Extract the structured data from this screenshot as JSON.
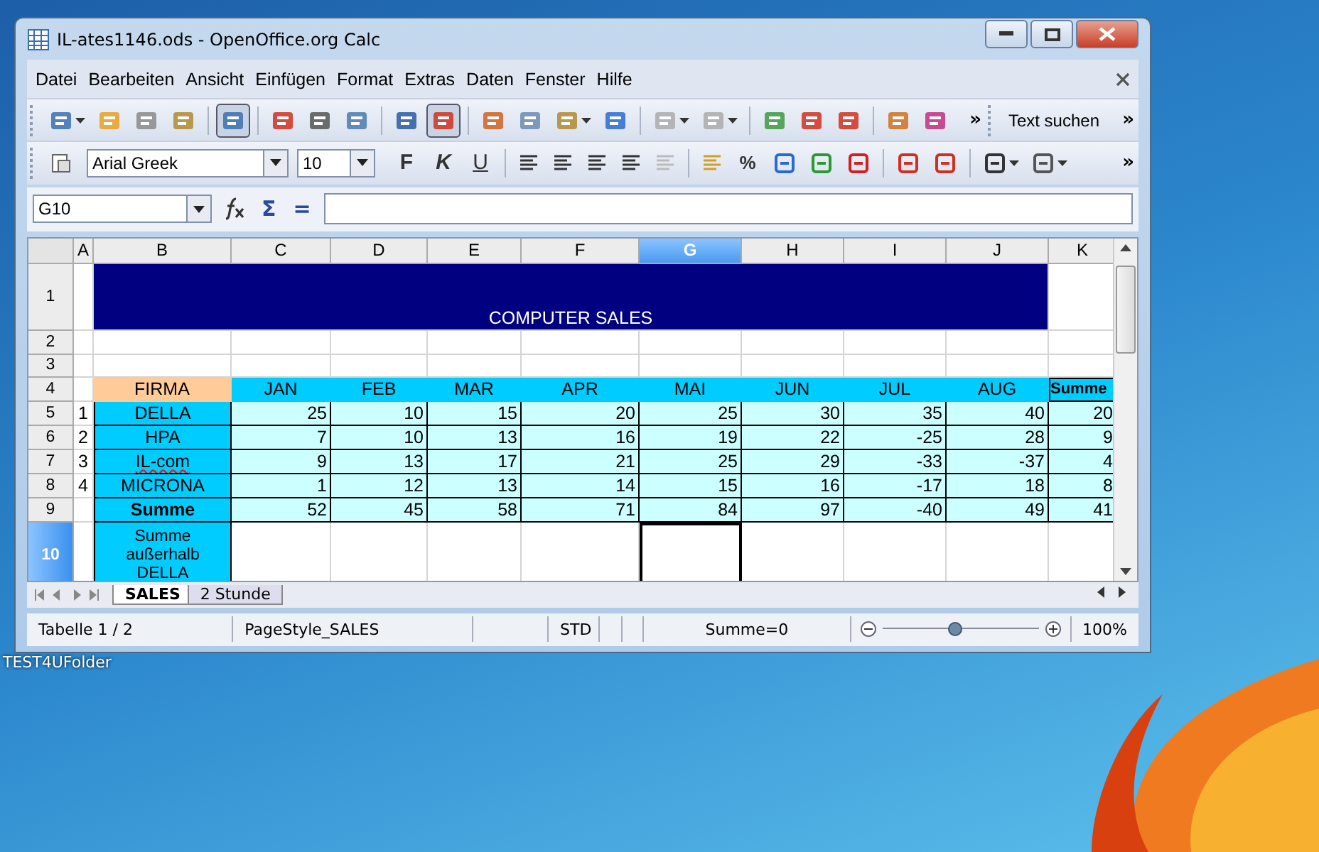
{
  "window": {
    "title": "IL-ates1146.ods - OpenOffice.org Calc"
  },
  "menu": [
    "Datei",
    "Bearbeiten",
    "Ansicht",
    "Einfügen",
    "Format",
    "Extras",
    "Daten",
    "Fenster",
    "Hilfe"
  ],
  "toolbar": {
    "overflow": "»",
    "find_label": "Text suchen"
  },
  "format_bar": {
    "font": "Arial Greek",
    "size": "10",
    "text_buttons": [
      "F",
      "K",
      "U"
    ],
    "percent": "%",
    "overflow": "»"
  },
  "formula_bar": {
    "name_box": "G10",
    "buttons": [
      "Σ",
      "="
    ]
  },
  "sheet": {
    "columns": [
      {
        "label": "A",
        "selected": false
      },
      {
        "label": "B",
        "selected": false
      },
      {
        "label": "C",
        "selected": false
      },
      {
        "label": "D",
        "selected": false
      },
      {
        "label": "E",
        "selected": false
      },
      {
        "label": "F",
        "selected": false
      },
      {
        "label": "G",
        "selected": true
      },
      {
        "label": "H",
        "selected": false
      },
      {
        "label": "I",
        "selected": false
      },
      {
        "label": "J",
        "selected": false
      },
      {
        "label": "K",
        "selected": false
      }
    ],
    "rows": [
      {
        "number": "1",
        "kind": "title",
        "selected": false,
        "text": "COMPUTER SALES"
      },
      {
        "number": "2",
        "kind": "blank",
        "selected": false
      },
      {
        "number": "3",
        "kind": "blank",
        "selected": false
      },
      {
        "number": "4",
        "kind": "header",
        "selected": false,
        "label": "FIRMA",
        "values": [
          "JAN",
          "FEB",
          "MAR",
          "APR",
          "MAI",
          "JUN",
          "JUL",
          "AUG"
        ],
        "total": "Summe"
      },
      {
        "number": "5",
        "kind": "data",
        "selected": false,
        "index": "1",
        "label": "DELLA",
        "spell_error": false,
        "values": [
          "25",
          "10",
          "15",
          "20",
          "25",
          "30",
          "35",
          "40"
        ],
        "total": "20"
      },
      {
        "number": "6",
        "kind": "data",
        "selected": false,
        "index": "2",
        "label": "HPA",
        "spell_error": false,
        "values": [
          "7",
          "10",
          "13",
          "16",
          "19",
          "22",
          "-25",
          "28"
        ],
        "total": "9"
      },
      {
        "number": "7",
        "kind": "data",
        "selected": false,
        "index": "3",
        "label": "IL-com",
        "spell_error": true,
        "values": [
          "9",
          "13",
          "17",
          "21",
          "25",
          "29",
          "-33",
          "-37"
        ],
        "total": "4"
      },
      {
        "number": "8",
        "kind": "data",
        "selected": false,
        "index": "4",
        "label": "MICRONA",
        "spell_error": false,
        "values": [
          "1",
          "12",
          "13",
          "14",
          "15",
          "16",
          "-17",
          "18"
        ],
        "total": "8"
      },
      {
        "number": "9",
        "kind": "total",
        "selected": false,
        "label": "Summe",
        "values": [
          "52",
          "45",
          "58",
          "71",
          "84",
          "97",
          "-40",
          "49"
        ],
        "total": "41"
      },
      {
        "number": "10",
        "kind": "note",
        "selected": true,
        "label": "Summe außerhalb DELLA"
      }
    ]
  },
  "sheet_tabs": [
    {
      "label": "SALES",
      "selected": true
    },
    {
      "label": "2 Stunde",
      "selected": false
    }
  ],
  "status_bar": {
    "sheet": "Tabelle 1 / 2",
    "page_style": "PageStyle_SALES",
    "mode": "STD",
    "sum": "Summe=0",
    "zoom": {
      "level": 0.46
    },
    "zoom_text": "100%"
  },
  "desktop": {
    "icon_label": "TEST4UFolder"
  }
}
